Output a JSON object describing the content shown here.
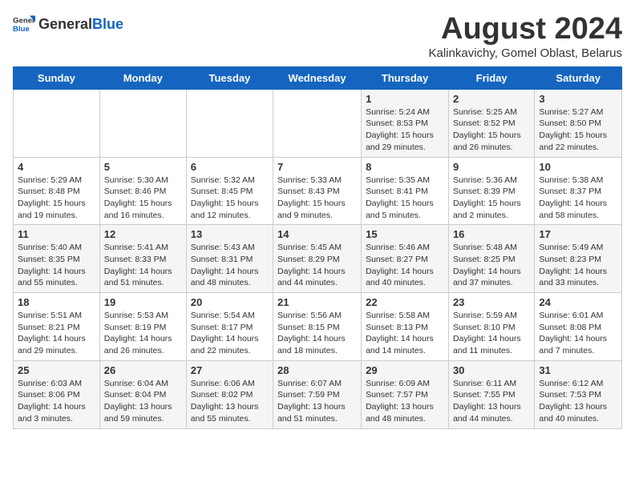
{
  "logo": {
    "general": "General",
    "blue": "Blue"
  },
  "title": "August 2024",
  "subtitle": "Kalinkavichy, Gomel Oblast, Belarus",
  "days_of_week": [
    "Sunday",
    "Monday",
    "Tuesday",
    "Wednesday",
    "Thursday",
    "Friday",
    "Saturday"
  ],
  "weeks": [
    [
      {
        "day": "",
        "detail": ""
      },
      {
        "day": "",
        "detail": ""
      },
      {
        "day": "",
        "detail": ""
      },
      {
        "day": "",
        "detail": ""
      },
      {
        "day": "1",
        "detail": "Sunrise: 5:24 AM\nSunset: 8:53 PM\nDaylight: 15 hours and 29 minutes."
      },
      {
        "day": "2",
        "detail": "Sunrise: 5:25 AM\nSunset: 8:52 PM\nDaylight: 15 hours and 26 minutes."
      },
      {
        "day": "3",
        "detail": "Sunrise: 5:27 AM\nSunset: 8:50 PM\nDaylight: 15 hours and 22 minutes."
      }
    ],
    [
      {
        "day": "4",
        "detail": "Sunrise: 5:29 AM\nSunset: 8:48 PM\nDaylight: 15 hours and 19 minutes."
      },
      {
        "day": "5",
        "detail": "Sunrise: 5:30 AM\nSunset: 8:46 PM\nDaylight: 15 hours and 16 minutes."
      },
      {
        "day": "6",
        "detail": "Sunrise: 5:32 AM\nSunset: 8:45 PM\nDaylight: 15 hours and 12 minutes."
      },
      {
        "day": "7",
        "detail": "Sunrise: 5:33 AM\nSunset: 8:43 PM\nDaylight: 15 hours and 9 minutes."
      },
      {
        "day": "8",
        "detail": "Sunrise: 5:35 AM\nSunset: 8:41 PM\nDaylight: 15 hours and 5 minutes."
      },
      {
        "day": "9",
        "detail": "Sunrise: 5:36 AM\nSunset: 8:39 PM\nDaylight: 15 hours and 2 minutes."
      },
      {
        "day": "10",
        "detail": "Sunrise: 5:38 AM\nSunset: 8:37 PM\nDaylight: 14 hours and 58 minutes."
      }
    ],
    [
      {
        "day": "11",
        "detail": "Sunrise: 5:40 AM\nSunset: 8:35 PM\nDaylight: 14 hours and 55 minutes."
      },
      {
        "day": "12",
        "detail": "Sunrise: 5:41 AM\nSunset: 8:33 PM\nDaylight: 14 hours and 51 minutes."
      },
      {
        "day": "13",
        "detail": "Sunrise: 5:43 AM\nSunset: 8:31 PM\nDaylight: 14 hours and 48 minutes."
      },
      {
        "day": "14",
        "detail": "Sunrise: 5:45 AM\nSunset: 8:29 PM\nDaylight: 14 hours and 44 minutes."
      },
      {
        "day": "15",
        "detail": "Sunrise: 5:46 AM\nSunset: 8:27 PM\nDaylight: 14 hours and 40 minutes."
      },
      {
        "day": "16",
        "detail": "Sunrise: 5:48 AM\nSunset: 8:25 PM\nDaylight: 14 hours and 37 minutes."
      },
      {
        "day": "17",
        "detail": "Sunrise: 5:49 AM\nSunset: 8:23 PM\nDaylight: 14 hours and 33 minutes."
      }
    ],
    [
      {
        "day": "18",
        "detail": "Sunrise: 5:51 AM\nSunset: 8:21 PM\nDaylight: 14 hours and 29 minutes."
      },
      {
        "day": "19",
        "detail": "Sunrise: 5:53 AM\nSunset: 8:19 PM\nDaylight: 14 hours and 26 minutes."
      },
      {
        "day": "20",
        "detail": "Sunrise: 5:54 AM\nSunset: 8:17 PM\nDaylight: 14 hours and 22 minutes."
      },
      {
        "day": "21",
        "detail": "Sunrise: 5:56 AM\nSunset: 8:15 PM\nDaylight: 14 hours and 18 minutes."
      },
      {
        "day": "22",
        "detail": "Sunrise: 5:58 AM\nSunset: 8:13 PM\nDaylight: 14 hours and 14 minutes."
      },
      {
        "day": "23",
        "detail": "Sunrise: 5:59 AM\nSunset: 8:10 PM\nDaylight: 14 hours and 11 minutes."
      },
      {
        "day": "24",
        "detail": "Sunrise: 6:01 AM\nSunset: 8:08 PM\nDaylight: 14 hours and 7 minutes."
      }
    ],
    [
      {
        "day": "25",
        "detail": "Sunrise: 6:03 AM\nSunset: 8:06 PM\nDaylight: 14 hours and 3 minutes."
      },
      {
        "day": "26",
        "detail": "Sunrise: 6:04 AM\nSunset: 8:04 PM\nDaylight: 13 hours and 59 minutes."
      },
      {
        "day": "27",
        "detail": "Sunrise: 6:06 AM\nSunset: 8:02 PM\nDaylight: 13 hours and 55 minutes."
      },
      {
        "day": "28",
        "detail": "Sunrise: 6:07 AM\nSunset: 7:59 PM\nDaylight: 13 hours and 51 minutes."
      },
      {
        "day": "29",
        "detail": "Sunrise: 6:09 AM\nSunset: 7:57 PM\nDaylight: 13 hours and 48 minutes."
      },
      {
        "day": "30",
        "detail": "Sunrise: 6:11 AM\nSunset: 7:55 PM\nDaylight: 13 hours and 44 minutes."
      },
      {
        "day": "31",
        "detail": "Sunrise: 6:12 AM\nSunset: 7:53 PM\nDaylight: 13 hours and 40 minutes."
      }
    ]
  ]
}
